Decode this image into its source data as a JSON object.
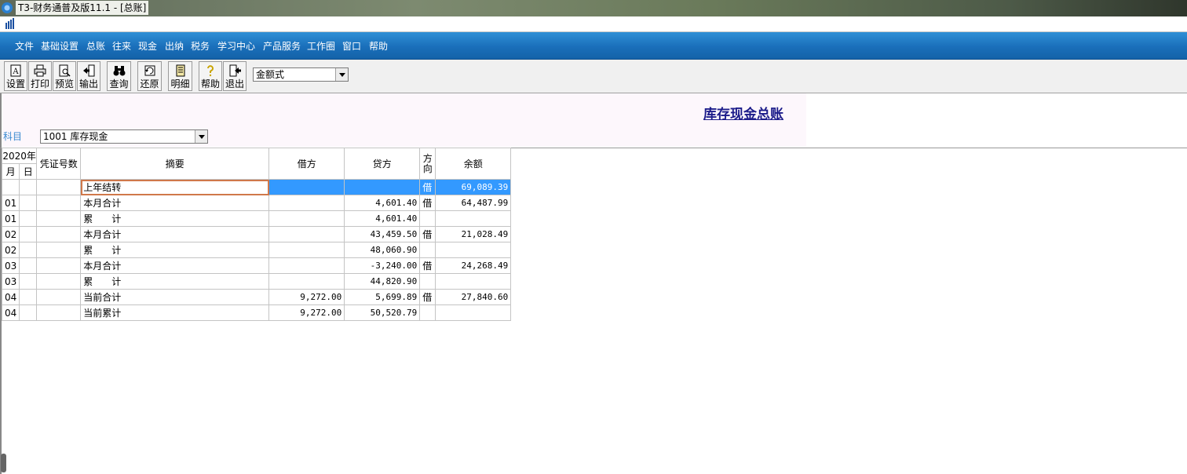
{
  "window": {
    "title": "T3-财务通普及版11.1 - [总账]"
  },
  "menu": [
    "文件",
    "基础设置",
    "总账",
    "往来",
    "现金",
    "出纳",
    "税务",
    "学习中心",
    "产品服务",
    "工作圈",
    "窗口",
    "帮助"
  ],
  "toolbar": {
    "buttons": [
      {
        "label": "设置",
        "icon": "settings-icon"
      },
      {
        "label": "打印",
        "icon": "print-icon"
      },
      {
        "label": "预览",
        "icon": "preview-icon"
      },
      {
        "label": "输出",
        "icon": "export-icon"
      },
      {
        "label": "查询",
        "icon": "binoculars-icon"
      },
      {
        "label": "还原",
        "icon": "restore-icon"
      },
      {
        "label": "明细",
        "icon": "detail-icon"
      },
      {
        "label": "帮助",
        "icon": "help-icon"
      },
      {
        "label": "退出",
        "icon": "exit-icon"
      }
    ],
    "format_select": "金额式"
  },
  "report": {
    "title": "库存现金总账",
    "subject_label": "科目",
    "subject_value": "1001 库存现金"
  },
  "table": {
    "headers": {
      "year": "2020年",
      "month": "月",
      "day": "日",
      "voucher": "凭证号数",
      "summary": "摘要",
      "debit": "借方",
      "credit": "贷方",
      "direction": "方向",
      "balance": "余额"
    },
    "rows": [
      {
        "month": "",
        "day": "",
        "voucher": "",
        "summary": "上年结转",
        "debit": "",
        "credit": "",
        "direction": "借",
        "balance": "69,089.39",
        "selected": true
      },
      {
        "month": "01",
        "day": "",
        "voucher": "",
        "summary": "本月合计",
        "debit": "",
        "credit": "4,601.40",
        "direction": "借",
        "balance": "64,487.99"
      },
      {
        "month": "01",
        "day": "",
        "voucher": "",
        "summary": "累　　计",
        "debit": "",
        "credit": "4,601.40",
        "direction": "",
        "balance": ""
      },
      {
        "month": "02",
        "day": "",
        "voucher": "",
        "summary": "本月合计",
        "debit": "",
        "credit": "43,459.50",
        "direction": "借",
        "balance": "21,028.49"
      },
      {
        "month": "02",
        "day": "",
        "voucher": "",
        "summary": "累　　计",
        "debit": "",
        "credit": "48,060.90",
        "direction": "",
        "balance": ""
      },
      {
        "month": "03",
        "day": "",
        "voucher": "",
        "summary": "本月合计",
        "debit": "",
        "credit": "-3,240.00",
        "direction": "借",
        "balance": "24,268.49"
      },
      {
        "month": "03",
        "day": "",
        "voucher": "",
        "summary": "累　　计",
        "debit": "",
        "credit": "44,820.90",
        "direction": "",
        "balance": ""
      },
      {
        "month": "04",
        "day": "",
        "voucher": "",
        "summary": "当前合计",
        "debit": "9,272.00",
        "credit": "5,699.89",
        "direction": "借",
        "balance": "27,840.60"
      },
      {
        "month": "04",
        "day": "",
        "voucher": "",
        "summary": "当前累计",
        "debit": "9,272.00",
        "credit": "50,520.79",
        "direction": "",
        "balance": ""
      }
    ]
  }
}
